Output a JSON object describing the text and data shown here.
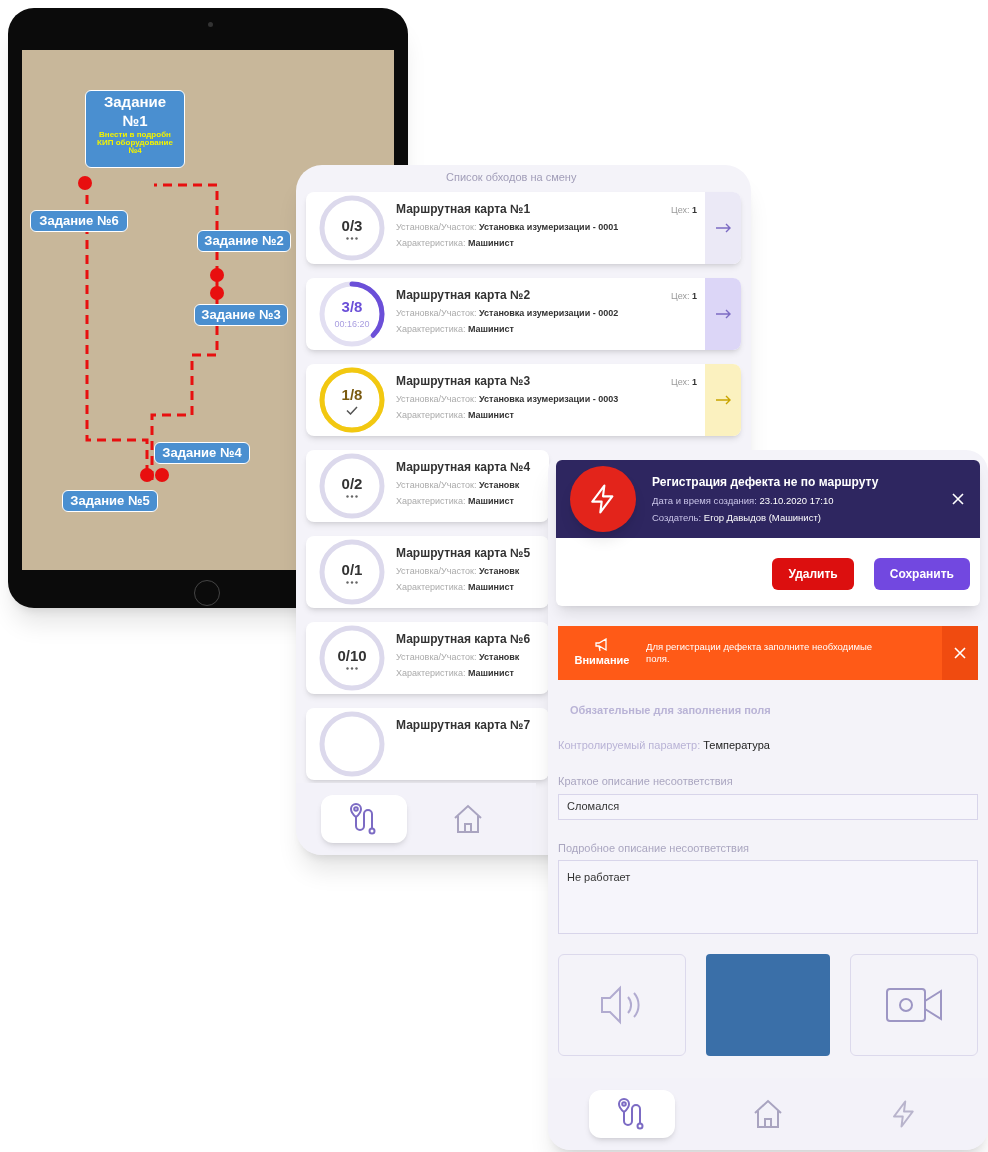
{
  "tablet": {
    "map": {
      "callouts": [
        {
          "title": "Задание №1",
          "note": "Внести в подробн КИП оборудование №4"
        },
        {
          "title": "Задание №6"
        },
        {
          "title": "Задание №2"
        },
        {
          "title": "Задание №3"
        },
        {
          "title": "Задание №4"
        },
        {
          "title": "Задание №5"
        }
      ]
    }
  },
  "route_list": {
    "title": "Список обходов на смену",
    "cards": [
      {
        "kind": "pending",
        "count": "0/3",
        "level": 0,
        "title": "Маршрутная карта №1",
        "workshop_label": "Цех:",
        "workshop": "1",
        "site_label": "Установка/Участок:",
        "site": "Установка изумеризации - 0001",
        "role_label": "Характеристика:",
        "role": "Машинист"
      },
      {
        "kind": "active",
        "count": "3/8",
        "timer": "00:16:20",
        "level": 0.375,
        "title": "Маршрутная карта №2",
        "workshop_label": "Цех:",
        "workshop": "1",
        "site_label": "Установка/Участок:",
        "site": "Установка изумеризации - 0002",
        "role_label": "Характеристика:",
        "role": "Машинист"
      },
      {
        "kind": "done",
        "count": "1/8",
        "level": 1,
        "title": "Маршрутная карта №3",
        "workshop_label": "Цех:",
        "workshop": "1",
        "site_label": "Установка/Участок:",
        "site": "Установка изумеризации - 0003",
        "role_label": "Характеристика:",
        "role": "Машинист"
      },
      {
        "kind": "pending",
        "count": "0/2",
        "level": 0,
        "title": "Маршрутная карта №4",
        "site_label": "Установка/Участок:",
        "site": "Установк",
        "role_label": "Характеристика:",
        "role": "Машинист"
      },
      {
        "kind": "pending",
        "count": "0/1",
        "level": 0,
        "title": "Маршрутная карта №5",
        "site_label": "Установка/Участок:",
        "site": "Установк",
        "role_label": "Характеристика:",
        "role": "Машинист"
      },
      {
        "kind": "pending",
        "count": "0/10",
        "level": 0,
        "title": "Маршрутная карта №6",
        "site_label": "Установка/Участок:",
        "site": "Установк",
        "role_label": "Характеристика:",
        "role": "Машинист"
      },
      {
        "kind": "pending",
        "title": "Маршрутная карта №7"
      }
    ],
    "nav": [
      {
        "kind": "route",
        "selected": true
      },
      {
        "kind": "home",
        "selected": false
      }
    ]
  },
  "defect_form": {
    "header": {
      "title": "Регистрация дефекта не по маршруту",
      "created_label": "Дата и время создания:",
      "created": "23.10.2020  17:10",
      "creator_label": "Создатель:",
      "creator": "Егор Давыдов (Машинист)"
    },
    "buttons": [
      {
        "kind": "danger",
        "label": "Удалить"
      },
      {
        "kind": "primary",
        "label": "Сохранить"
      }
    ],
    "alert": {
      "title": "Внимание",
      "message": "Для регистрации дефекта заполните необходимые поля."
    },
    "section_title": "Обязательные для заполнения поля",
    "parameter_label": "Контролируемый параметр:",
    "parameter": "Температура",
    "fields": [
      {
        "kind": "line",
        "label": "Краткое описание несоответствия",
        "value": "Сломался"
      },
      {
        "kind": "area",
        "label": "Подробное описание несоответствия",
        "value": "Не работает"
      }
    ],
    "attachments": [
      {
        "kind": "audio"
      },
      {
        "kind": "photo"
      },
      {
        "kind": "video"
      }
    ],
    "nav": [
      {
        "kind": "route",
        "selected": true
      },
      {
        "kind": "home",
        "selected": false
      },
      {
        "kind": "defect",
        "selected": false
      }
    ]
  }
}
